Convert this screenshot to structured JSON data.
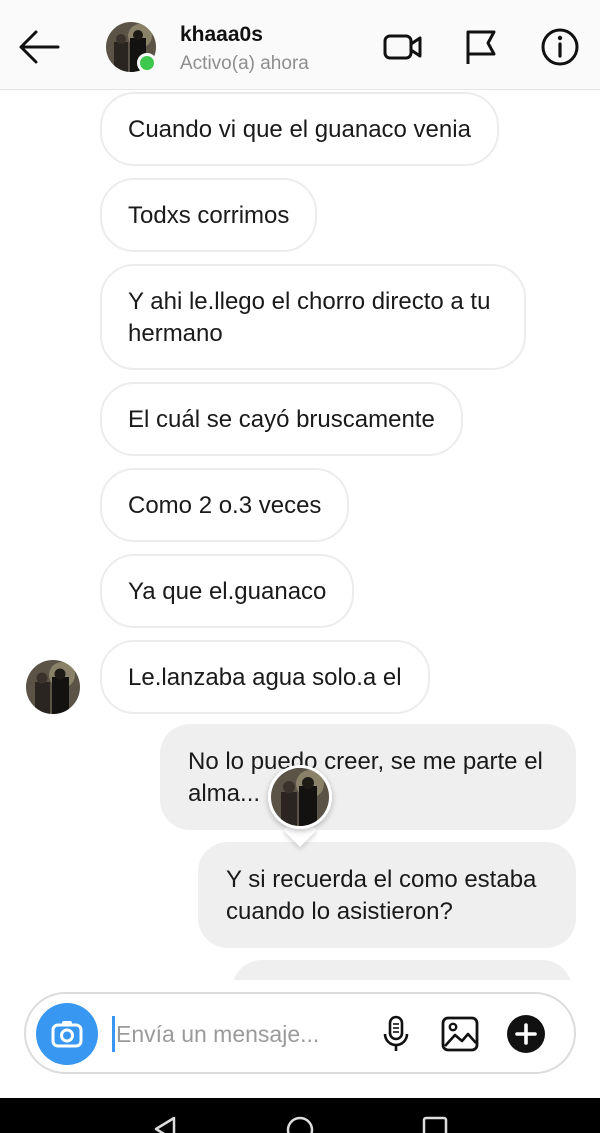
{
  "header": {
    "username": "khaaa0s",
    "status": "Activo(a) ahora",
    "icons": [
      "back-arrow-icon",
      "video-camera-icon",
      "flag-icon",
      "info-icon"
    ]
  },
  "messages": {
    "incoming": [
      "Cuando vi que el guanaco venia",
      "Todxs corrimos",
      "Y ahi le.llego el chorro directo a tu hermano",
      "El cuál se cayó bruscamente",
      "Como 2 o.3 veces",
      "Ya que el.guanaco",
      "Le.lanzaba agua solo.a el"
    ],
    "outgoing": [
      "No lo puedo creer, se me parte el alma...",
      "Y si recuerda el como estaba cuando lo asistieron?"
    ]
  },
  "composer": {
    "placeholder": "Envía un mensaje...",
    "icons": [
      "camera-icon",
      "microphone-icon",
      "gallery-icon",
      "plus-icon"
    ]
  },
  "colors": {
    "accent": "#3897f0",
    "online": "#3ec94e",
    "incoming_border": "#ececec",
    "outgoing_bg": "#efefef"
  }
}
